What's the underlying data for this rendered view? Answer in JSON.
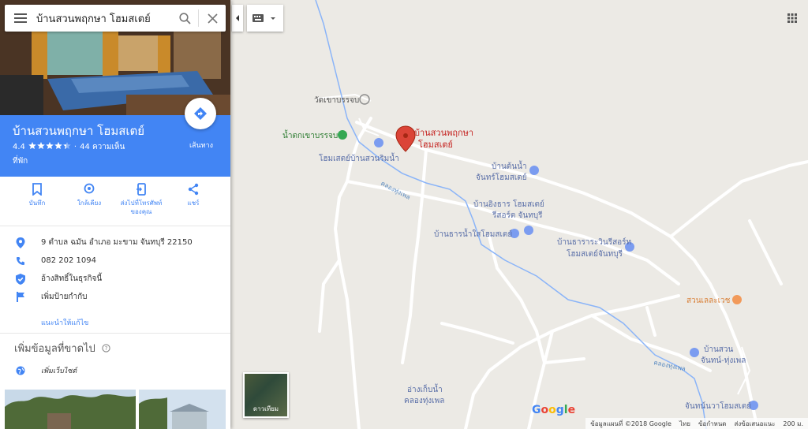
{
  "search": {
    "query": "บ้านสวนพฤกษา โฮมสเตย์"
  },
  "place": {
    "name": "บ้านสวนพฤกษา โฮมสเตย์",
    "rating": "4.4",
    "stars": 4.4,
    "reviews": "44 ความเห็น",
    "category": "ที่พัก",
    "directions_label": "เส้นทาง"
  },
  "actions": [
    {
      "label": "บันทึก",
      "icon": "bookmark-icon"
    },
    {
      "label": "ใกล้เคียง",
      "icon": "nearby-icon"
    },
    {
      "label": "ส่งไปที่โทรศัพท์ของคุณ",
      "icon": "send-to-phone-icon"
    },
    {
      "label": "แชร์",
      "icon": "share-icon"
    }
  ],
  "info": {
    "address": "9 ตำบล ฉมัน อำเภอ มะขาม จันทบุรี 22150",
    "phone": "082 202 1094",
    "claim": "อ้างสิทธิ์ในธุรกิจนี้",
    "add_label": "เพิ่มป้ายกำกับ",
    "suggest_edit": "แนะนำให้แก้ไข"
  },
  "missing": {
    "title": "เพิ่มข้อมูลที่ขาดไป",
    "add_website": "เพิ่มเว็บไซต์"
  },
  "map": {
    "labels": {
      "temple": "วัดเขาบรรจบ",
      "waterfall": "น้ำตกเขาบรรจบ",
      "homestay_riverside": "โฮมเสตย์บ้านสวนริมน้ำ",
      "pin1": "บ้านสวนพฤกษา",
      "pin2": "โฮมสเตย์",
      "baanton1": "บ้านต้นน้ำ",
      "baanton2": "จันทร์โฮมสเตย์",
      "canal": "คลองทุ่งเพล",
      "ingthan1": "บ้านอิงธาร โฮมสเตย์",
      "ingthan2": "รีสอร์ต จันทบุรี",
      "thannam": "บ้านธารน้ำใสโฮมสเตย์",
      "thara1": "บ้านธาราระวินรีสอร์ท",
      "thara2": "โฮมสเตย์จันทบุรี",
      "garden": "สวนเลละเวช",
      "canal2": "คลองทุ่งเพล",
      "suan1": "บ้านสวน",
      "suan2": "จันทน์-ทุ่งเพล",
      "reservoir1": "อ่างเก็บน้ำ",
      "reservoir2": "คลองทุ่งเพล",
      "chanwara": "จันทน์นวาโฮมสเตย์"
    },
    "satellite": "ดาวเทียม",
    "footer": [
      "ข้อมูลแผนที่ ©2018 Google",
      "ไทย",
      "ข้อกำหนด",
      "ส่งข้อเสนอแนะ",
      "200 ม."
    ],
    "brand": "Google",
    "colors": {
      "road": "#ffffff",
      "water": "#8ab4f8",
      "land": "#eceae5",
      "pin": "#db4437",
      "poi_lodging": "#7b9cf0",
      "accent": "#4285f4"
    }
  }
}
